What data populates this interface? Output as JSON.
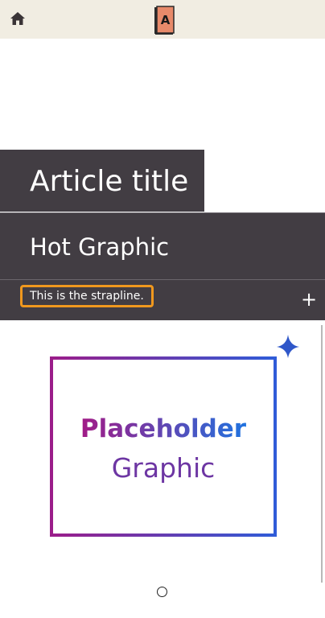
{
  "header": {
    "home_icon": "home-icon",
    "logo_letter": "A",
    "logo_icon": "book-logo-icon"
  },
  "article": {
    "title": "Article title",
    "subtitle": "Hot Graphic",
    "strapline": "This is the strapline.",
    "expand_icon": "+"
  },
  "graphic": {
    "line1": "Placeholder",
    "line2": "Graphic",
    "sparkle_icon": "sparkle-icon"
  },
  "carousel": {
    "dot_icon": "carousel-dot"
  },
  "colors": {
    "header_bg": "#f1ede2",
    "panel_bg": "#423d43",
    "strap_border": "#f0981e",
    "gradient_start": "#9b1d8a",
    "gradient_end": "#2f5cd8"
  }
}
